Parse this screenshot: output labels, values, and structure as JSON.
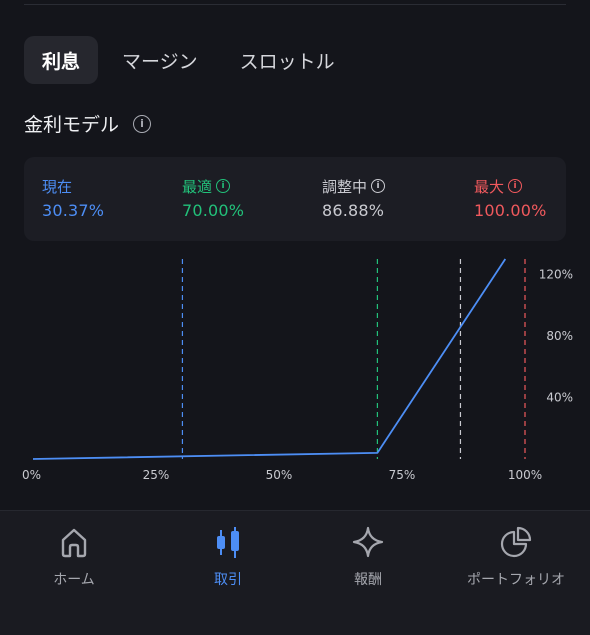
{
  "tabs": [
    {
      "label": "利息",
      "active": true
    },
    {
      "label": "マージン",
      "active": false
    },
    {
      "label": "スロットル",
      "active": false
    }
  ],
  "section": {
    "title": "金利モデル"
  },
  "stats": {
    "current": {
      "label": "現在",
      "value": "30.37%",
      "color": "#4d8ef5"
    },
    "optimal": {
      "label": "最適",
      "value": "70.00%",
      "color": "#22c17a"
    },
    "adjusting": {
      "label": "調整中",
      "value": "86.88%",
      "color": "#c9cad0"
    },
    "max": {
      "label": "最大",
      "value": "100.00%",
      "color": "#f0595d"
    }
  },
  "chart_data": {
    "type": "line",
    "x_tick_labels": [
      "0%",
      "25%",
      "50%",
      "75%",
      "100%"
    ],
    "y_tick_labels": [
      "40%",
      "80%",
      "120%"
    ],
    "xlim": [
      0,
      100
    ],
    "ylim": [
      0,
      130
    ],
    "x": [
      0,
      70,
      96
    ],
    "y": [
      0,
      4,
      130
    ],
    "markers": [
      {
        "value": 30.37,
        "color": "#4d8ef5"
      },
      {
        "value": 70.0,
        "color": "#22c17a"
      },
      {
        "value": 86.88,
        "color": "#c9cad0"
      },
      {
        "value": 100.0,
        "color": "#f0595d"
      }
    ],
    "line_color": "#4d8ef5"
  },
  "nav": [
    {
      "label": "ホーム",
      "icon": "home-icon",
      "active": false
    },
    {
      "label": "取引",
      "icon": "candlestick-icon",
      "active": true
    },
    {
      "label": "報酬",
      "icon": "sparkle-icon",
      "active": false
    },
    {
      "label": "ポートフォリオ",
      "icon": "pie-chart-icon",
      "active": false
    }
  ]
}
